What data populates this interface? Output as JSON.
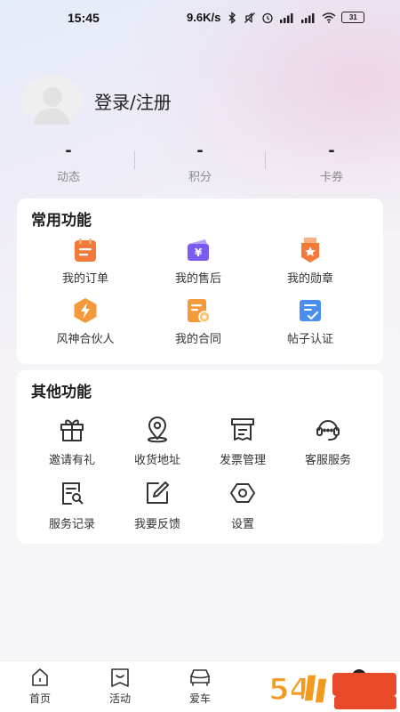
{
  "status_bar": {
    "time": "15:45",
    "network_speed": "9.6K/s",
    "battery": "31",
    "icons": [
      "bluetooth-icon",
      "mute-icon",
      "alarm-icon",
      "signal-icon",
      "wifi-icon",
      "battery-icon"
    ]
  },
  "profile": {
    "login_text": "登录/注册",
    "stats": [
      {
        "value": "-",
        "label": "动态"
      },
      {
        "value": "-",
        "label": "积分"
      },
      {
        "value": "-",
        "label": "卡券"
      }
    ]
  },
  "common_functions": {
    "title": "常用功能",
    "items": [
      {
        "label": "我的订单",
        "icon": "order-icon"
      },
      {
        "label": "我的售后",
        "icon": "after-sales-icon"
      },
      {
        "label": "我的勋章",
        "icon": "medal-icon"
      },
      {
        "label": "风神合伙人",
        "icon": "partner-icon"
      },
      {
        "label": "我的合同",
        "icon": "contract-icon"
      },
      {
        "label": "帖子认证",
        "icon": "post-cert-icon"
      }
    ]
  },
  "other_functions": {
    "title": "其他功能",
    "items": [
      {
        "label": "邀请有礼",
        "icon": "gift-icon"
      },
      {
        "label": "收货地址",
        "icon": "location-icon"
      },
      {
        "label": "发票管理",
        "icon": "invoice-icon"
      },
      {
        "label": "客服服务",
        "icon": "headset-icon"
      },
      {
        "label": "服务记录",
        "icon": "record-icon"
      },
      {
        "label": "我要反馈",
        "icon": "feedback-icon"
      },
      {
        "label": "设置",
        "icon": "settings-icon"
      }
    ]
  },
  "bottom_nav": {
    "items": [
      {
        "label": "首页",
        "icon": "home-icon"
      },
      {
        "label": "活动",
        "icon": "activity-icon"
      },
      {
        "label": "爱车",
        "icon": "car-icon"
      }
    ]
  },
  "colors": {
    "orange_accent": "#f47a3a",
    "purple_accent": "#7a5cf0",
    "blue_accent": "#4a8ef0"
  }
}
